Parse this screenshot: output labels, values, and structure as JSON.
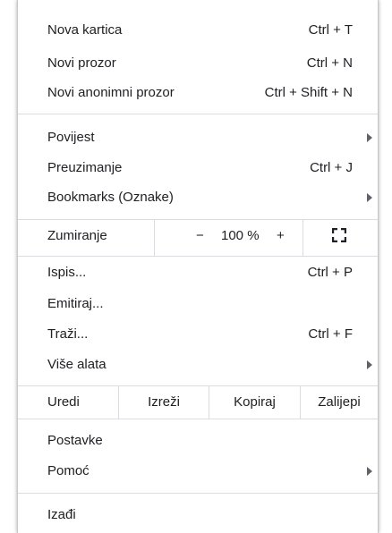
{
  "menu": {
    "new_tab": {
      "label": "Nova kartica",
      "shortcut": "Ctrl + T"
    },
    "new_window": {
      "label": "Novi prozor",
      "shortcut": "Ctrl + N"
    },
    "new_incognito": {
      "label": "Novi anonimni prozor",
      "shortcut": "Ctrl + Shift + N"
    },
    "history": {
      "label": "Povijest"
    },
    "downloads": {
      "label": "Preuzimanje",
      "shortcut": "Ctrl + J"
    },
    "bookmarks": {
      "label": "Bookmarks (Oznake)"
    },
    "zoom": {
      "label": "Zumiranje",
      "minus": "−",
      "value": "100 %",
      "plus": "+"
    },
    "print": {
      "label": "Ispis...",
      "shortcut": "Ctrl + P"
    },
    "cast": {
      "label": "Emitiraj..."
    },
    "find": {
      "label": "Traži...",
      "shortcut": "Ctrl + F"
    },
    "more_tools": {
      "label": "Više alata"
    },
    "edit": {
      "label": "Uredi",
      "cut": "Izreži",
      "copy": "Kopiraj",
      "paste": "Zalijepi"
    },
    "settings": {
      "label": "Postavke"
    },
    "help": {
      "label": "Pomoć"
    },
    "exit": {
      "label": "Izađi"
    }
  },
  "colors": {
    "text": "#202124",
    "separator": "#dadce0",
    "icon": "#5f6368"
  },
  "icons": [
    "submenu-arrow-icon",
    "fullscreen-icon"
  ]
}
